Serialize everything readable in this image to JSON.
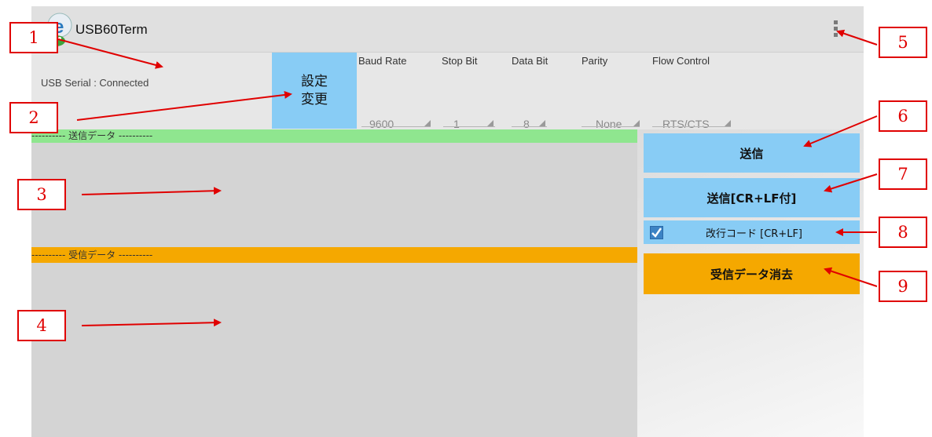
{
  "app": {
    "title": "USB60Term",
    "icon": "app-logo-icon",
    "menu_icon": "overflow-menu-icon"
  },
  "status": {
    "usb_serial": "USB Serial : Connected"
  },
  "settings": {
    "change_button": "設定\n変更",
    "fields": [
      {
        "label": "Baud Rate",
        "value": "9600"
      },
      {
        "label": "Stop Bit",
        "value": "1"
      },
      {
        "label": "Data Bit",
        "value": "8"
      },
      {
        "label": "Parity",
        "value": "None"
      },
      {
        "label": "Flow Control",
        "value": "RTS/CTS"
      }
    ]
  },
  "send": {
    "header": "---------- 送信データ ----------",
    "text": ""
  },
  "receive": {
    "header": "---------- 受信データ ----------",
    "text": ""
  },
  "buttons": {
    "send": "送信",
    "send_crlf": "送信[CR+LF付]",
    "crlf_checkbox": "改行コード [CR+LF]",
    "crlf_checked": true,
    "clear_receive": "受信データ消去"
  },
  "callouts": [
    "1",
    "2",
    "3",
    "4",
    "5",
    "6",
    "7",
    "8",
    "9"
  ],
  "colors": {
    "accent_blue": "#88ccf5",
    "send_header_green": "#8fe68f",
    "receive_orange": "#f5a800",
    "annotation_red": "#e00000"
  }
}
